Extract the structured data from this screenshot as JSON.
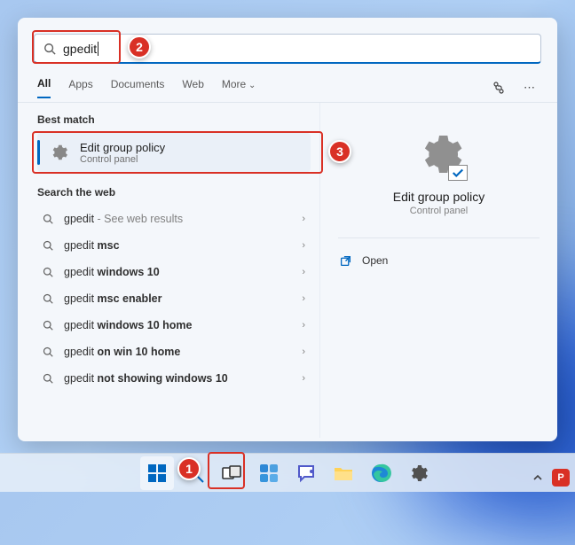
{
  "search": {
    "query": "gpedit"
  },
  "tabs": {
    "all": "All",
    "apps": "Apps",
    "documents": "Documents",
    "web": "Web",
    "more": "More"
  },
  "sections": {
    "best_match": "Best match",
    "search_web": "Search the web"
  },
  "best_match": {
    "title": "Edit group policy",
    "subtitle": "Control panel"
  },
  "web_results": [
    {
      "prefix": "gpedit",
      "bold": "",
      "suffix": " - See web results"
    },
    {
      "prefix": "gpedit ",
      "bold": "msc",
      "suffix": ""
    },
    {
      "prefix": "gpedit ",
      "bold": "windows 10",
      "suffix": ""
    },
    {
      "prefix": "gpedit ",
      "bold": "msc enabler",
      "suffix": ""
    },
    {
      "prefix": "gpedit ",
      "bold": "windows 10 home",
      "suffix": ""
    },
    {
      "prefix": "gpedit ",
      "bold": "on win 10 home",
      "suffix": ""
    },
    {
      "prefix": "gpedit ",
      "bold": "not showing windows 10",
      "suffix": ""
    }
  ],
  "preview": {
    "title": "Edit group policy",
    "subtitle": "Control panel",
    "open": "Open"
  },
  "callouts": {
    "c1": "1",
    "c2": "2",
    "c3": "3"
  }
}
